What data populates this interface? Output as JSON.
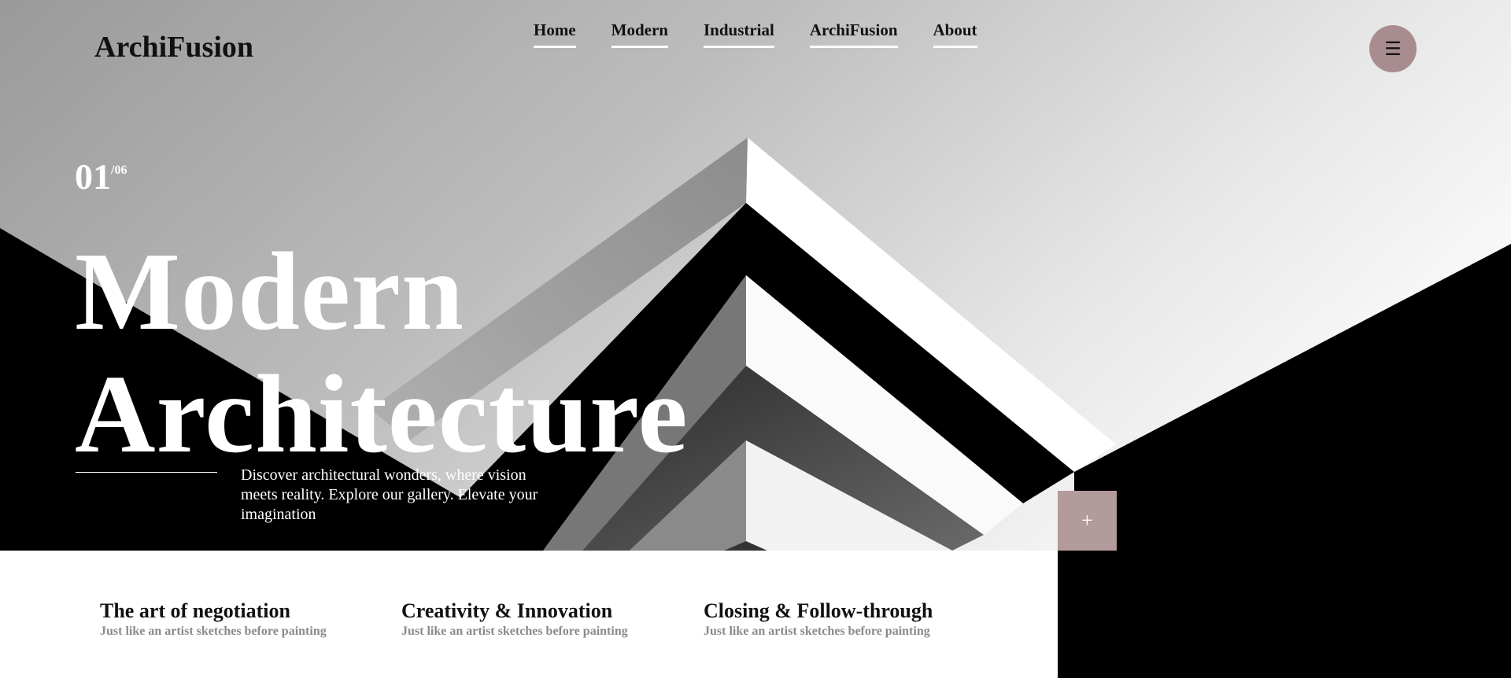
{
  "brand": {
    "name": "ArchiFusion"
  },
  "nav": {
    "items": [
      {
        "label": "Home"
      },
      {
        "label": "Modern"
      },
      {
        "label": "Industrial"
      },
      {
        "label": "ArchiFusion"
      },
      {
        "label": "About"
      }
    ]
  },
  "menu": {
    "icon": "hamburger-icon",
    "glyph": "☰"
  },
  "slide": {
    "current": "01",
    "total": "/06"
  },
  "hero": {
    "title_line1": "Modern",
    "title_line2": "Architecture",
    "description": "Discover architectural wonders, where vision meets reality. Explore our gallery. Elevate your imagination"
  },
  "plus_button": {
    "icon": "plus-icon",
    "glyph": "+"
  },
  "features": [
    {
      "title": "The art of negotiation",
      "subtitle": "Just like an artist sketches before painting"
    },
    {
      "title": "Creativity & Innovation",
      "subtitle": "Just like an artist sketches before painting"
    },
    {
      "title": "Closing & Follow-through",
      "subtitle": "Just like an artist sketches before painting"
    }
  ],
  "colors": {
    "menu_button": "#a88c8f",
    "plus_button": "#b39a9b",
    "text_dark": "#111111",
    "subtitle_gray": "#8a8a8a"
  }
}
